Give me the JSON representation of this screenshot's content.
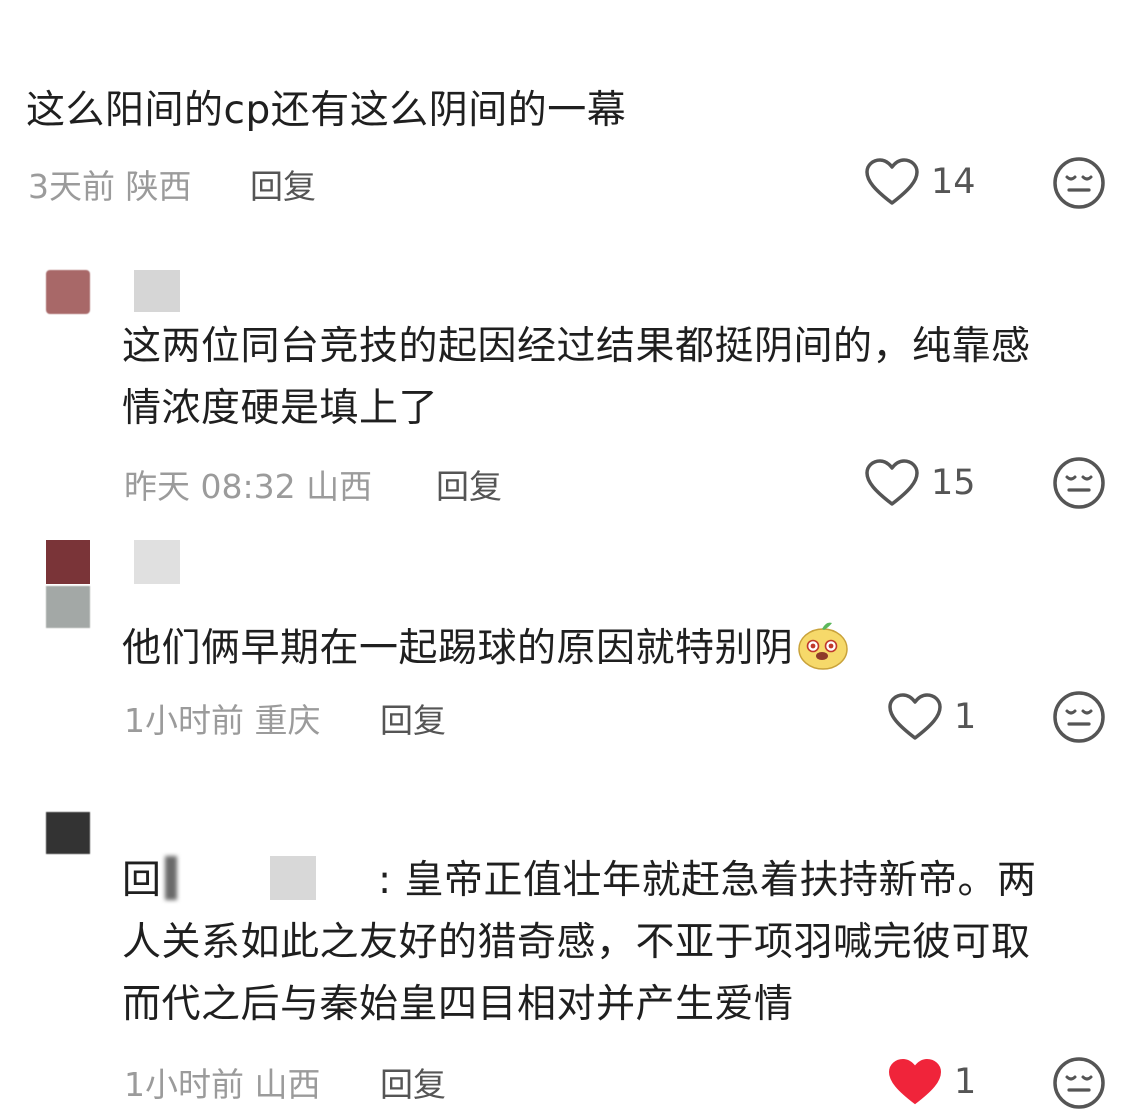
{
  "comments": [
    {
      "text": "这么阳间的cp还有这么阴间的一幕",
      "time": "3天前",
      "location": "陕西",
      "reply_label": "回复",
      "likes": "14",
      "liked": false
    },
    {
      "text_lines": [
        "这两位同台竞技的起因经过结果都挺阴间的，纯靠感",
        "情浓度硬是填上了"
      ],
      "time": "昨天 08:32",
      "location": "山西",
      "reply_label": "回复",
      "likes": "15",
      "liked": false
    },
    {
      "text": "他们俩早期在一起踢球的原因就特别阴",
      "time": "1小时前",
      "location": "重庆",
      "reply_label": "回复",
      "likes": "1",
      "liked": false
    },
    {
      "reply_prefix": "回",
      "text_line1": ": 皇帝正值壮年就赶急着扶持新帝。两",
      "text_lines": [
        "人关系如此之友好的猎奇感，不亚于项羽喊完彼可取",
        "而代之后与秦始皇四目相对并产生爱情"
      ],
      "time": "1小时前",
      "location": "山西",
      "reply_label": "回复",
      "likes": "1",
      "liked": true
    }
  ],
  "colors": {
    "liked_red": "#f0243a",
    "meta_gray": "#9b9b9b",
    "icon_gray": "#555555"
  }
}
